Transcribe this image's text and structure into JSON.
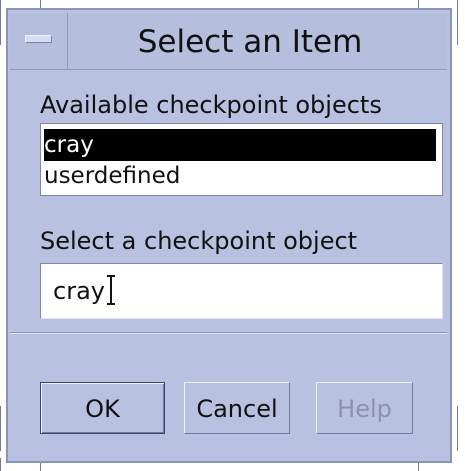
{
  "window": {
    "title": "Select an Item"
  },
  "dialog": {
    "available_label": "Available checkpoint objects",
    "items": [
      {
        "label": "cray",
        "selected": true
      },
      {
        "label": "userdefined",
        "selected": false
      }
    ],
    "select_label": "Select a checkpoint object",
    "input_value": "cray"
  },
  "buttons": {
    "ok": "OK",
    "cancel": "Cancel",
    "help": "Help"
  },
  "icons": {
    "window_menu": "window-menu-icon",
    "text_cursor": "text-cursor-icon"
  },
  "colors": {
    "window_bg": "#b8c2e0",
    "selection_bg": "#000000",
    "selection_fg": "#ffffff",
    "disabled_fg": "#8b92ad"
  }
}
